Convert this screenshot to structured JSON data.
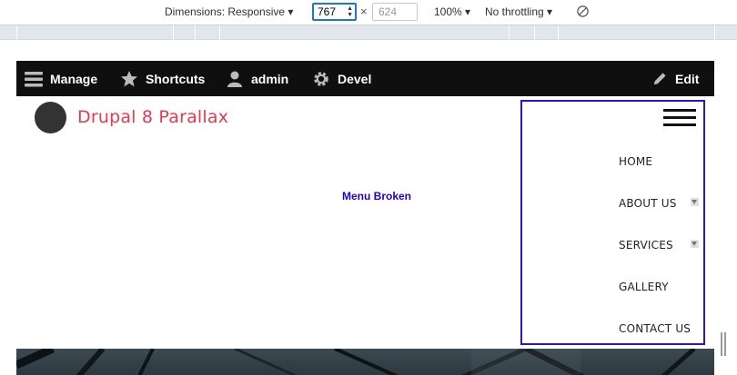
{
  "devtools": {
    "dimensions_label": "Dimensions: Responsive ▾",
    "width_value": "767",
    "times": "×",
    "height_placeholder": "624",
    "zoom": "100% ▾",
    "throttling": "No throttling ▾",
    "rotate_icon": "rotate-icon"
  },
  "toolbar": {
    "manage": "Manage",
    "shortcuts": "Shortcuts",
    "admin": "admin",
    "devel": "Devel",
    "edit": "Edit"
  },
  "site": {
    "name": "Drupal 8 Parallax"
  },
  "annotation": "Menu Broken",
  "nav": {
    "items": [
      {
        "label": "HOME",
        "has_children": false
      },
      {
        "label": "ABOUT US",
        "has_children": true
      },
      {
        "label": "SERVICES",
        "has_children": true
      },
      {
        "label": "GALLERY",
        "has_children": false
      },
      {
        "label": "CONTACT US",
        "has_children": false
      }
    ]
  },
  "colors": {
    "brand": "#e8394e",
    "toolbar_bg": "#0f0f0f",
    "highlight": "#2b14cc"
  }
}
